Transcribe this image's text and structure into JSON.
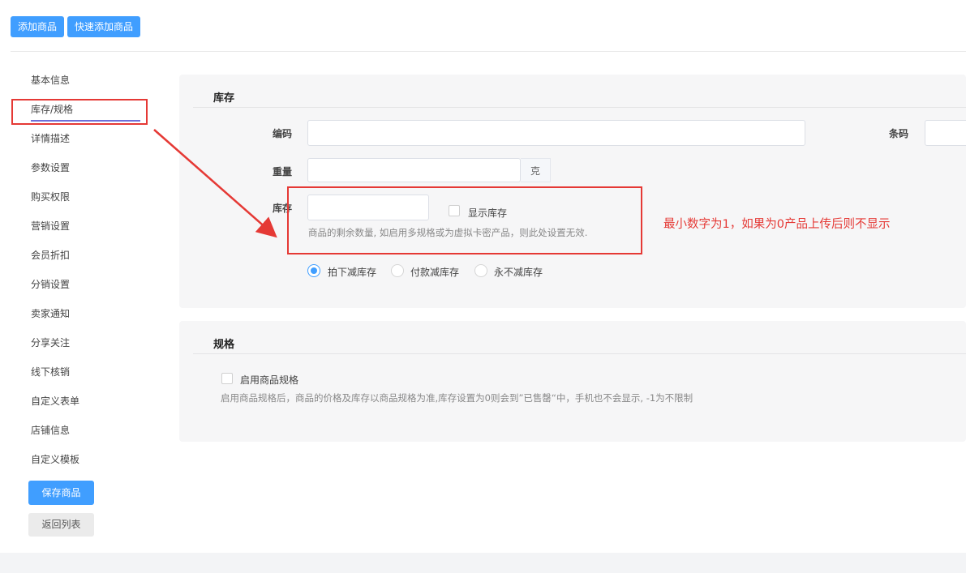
{
  "toolbar": {
    "add_goods": "添加商品",
    "quick_add_goods": "快速添加商品"
  },
  "sidebar": {
    "items": [
      {
        "label": "基本信息"
      },
      {
        "label": "库存/规格"
      },
      {
        "label": "详情描述"
      },
      {
        "label": "参数设置"
      },
      {
        "label": "购买权限"
      },
      {
        "label": "营销设置"
      },
      {
        "label": "会员折扣"
      },
      {
        "label": "分销设置"
      },
      {
        "label": "卖家通知"
      },
      {
        "label": "分享关注"
      },
      {
        "label": "线下核销"
      },
      {
        "label": "自定义表单"
      },
      {
        "label": "店铺信息"
      },
      {
        "label": "自定义模板"
      }
    ],
    "active_index": 1,
    "save_label": "保存商品",
    "back_label": "返回列表"
  },
  "stock_panel": {
    "title": "库存",
    "code_label": "编码",
    "code_value": "",
    "barcode_label": "条码",
    "barcode_value": "",
    "weight_label": "重量",
    "weight_value": "",
    "weight_unit": "克",
    "stock_label": "库存",
    "stock_value": "",
    "show_stock_label": "显示库存",
    "show_stock_checked": false,
    "stock_hint": "商品的剩余数量, 如启用多规格或为虚拟卡密产品，则此处设置无效.",
    "reduce_options": [
      {
        "label": "拍下减库存",
        "checked": true
      },
      {
        "label": "付款减库存",
        "checked": false
      },
      {
        "label": "永不减库存",
        "checked": false
      }
    ]
  },
  "spec_panel": {
    "title": "规格",
    "enable_label": "启用商品规格",
    "enable_checked": false,
    "hint": "启用商品规格后，商品的价格及库存以商品规格为准,库存设置为0则会到”已售罄“中，手机也不会显示, -1为不限制"
  },
  "annotation": {
    "text": "最小数字为1，如果为0产品上传后则不显示",
    "color": "#e53935"
  },
  "colors": {
    "primary": "#409eff",
    "panel_bg": "#f6f6f7",
    "annotation_red": "#e53935"
  }
}
